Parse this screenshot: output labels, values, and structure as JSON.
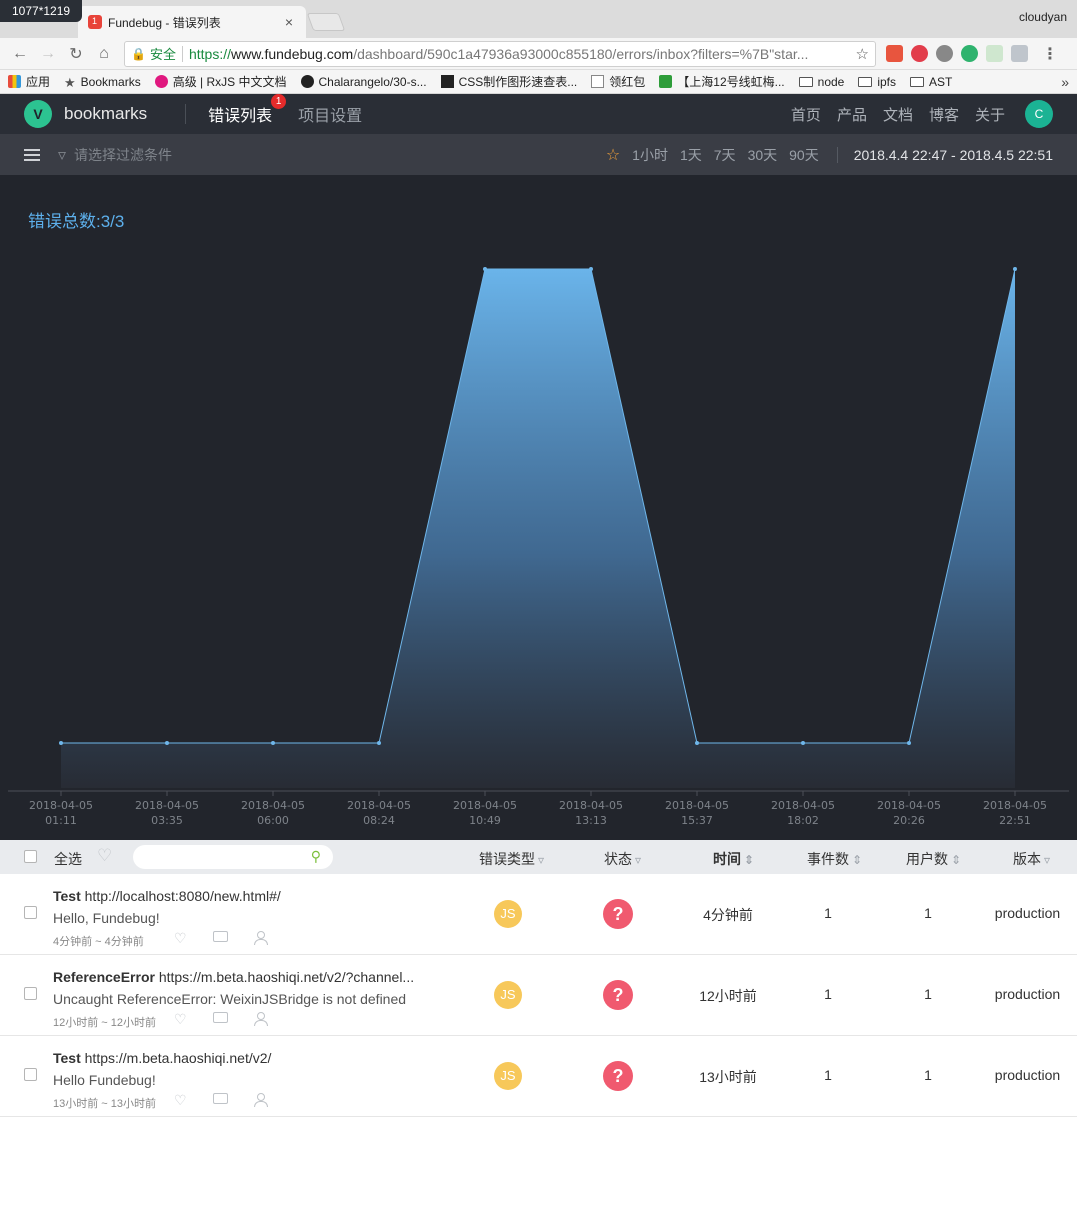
{
  "overlay": {
    "size_badge": "1077*1219"
  },
  "browser": {
    "tab_title": "Fundebug - 错误列表",
    "tab_close": "×",
    "profile_name": "cloudyan",
    "secure_label": "安全",
    "url_scheme": "https://",
    "url_host": "www.fundebug.com",
    "url_path": "/dashboard/590c1a47936a93000c855180/errors/inbox?filters=%7B\"star..."
  },
  "bookmarks_bar": {
    "items": [
      {
        "label": "应用",
        "icon": "apps-icon"
      },
      {
        "label": "Bookmarks",
        "icon": "star-icon"
      },
      {
        "label": "高级 | RxJS 中文文档",
        "icon": "rxjs-icon"
      },
      {
        "label": "Chalarangelo/30-s...",
        "icon": "github-icon"
      },
      {
        "label": "CSS制作图形速查表...",
        "icon": "css-icon"
      },
      {
        "label": "领红包",
        "icon": "doc-icon"
      },
      {
        "label": "【上海12号线虹梅...",
        "icon": "green-icon"
      },
      {
        "label": "node",
        "icon": "folder-icon"
      },
      {
        "label": "ipfs",
        "icon": "folder-icon"
      },
      {
        "label": "AST",
        "icon": "folder-icon"
      }
    ],
    "more": "»"
  },
  "app": {
    "logo_letter": "V",
    "project_name": "bookmarks",
    "tabs": [
      {
        "label": "错误列表",
        "badge": "1"
      },
      {
        "label": "项目设置"
      }
    ],
    "nav": [
      "首页",
      "产品",
      "文档",
      "博客",
      "关于"
    ],
    "user_initial": "C"
  },
  "filterbar": {
    "placeholder": "请选择过滤条件",
    "ranges": [
      "1小时",
      "1天",
      "7天",
      "30天",
      "90天"
    ],
    "date_range": "2018.4.4 22:47 - 2018.4.5 22:51"
  },
  "summary": {
    "total_errors": "错误总数:3/3"
  },
  "colors": {
    "chart_line": "#6fb6ea",
    "chart_fill_top": "#6ab4ea",
    "chart_bg": "#22252c",
    "accent_green": "#2cc391",
    "status_red": "#f05a6f",
    "js_yellow": "#f7c85a"
  },
  "chart_data": {
    "type": "area",
    "title": "错误总数:3/3",
    "x": [
      "2018-04-05 01:11",
      "2018-04-05 03:35",
      "2018-04-05 06:00",
      "2018-04-05 08:24",
      "2018-04-05 10:49",
      "2018-04-05 13:13",
      "2018-04-05 15:37",
      "2018-04-05 18:02",
      "2018-04-05 20:26",
      "2018-04-05 22:51"
    ],
    "tick_dates": [
      "2018-04-05",
      "2018-04-05",
      "2018-04-05",
      "2018-04-05",
      "2018-04-05",
      "2018-04-05",
      "2018-04-05",
      "2018-04-05",
      "2018-04-05",
      "2018-04-05"
    ],
    "tick_times": [
      "01:11",
      "03:35",
      "06:00",
      "08:24",
      "10:49",
      "13:13",
      "15:37",
      "18:02",
      "20:26",
      "22:51"
    ],
    "series": [
      {
        "values": [
          0,
          0,
          0,
          0,
          1,
          1,
          0,
          0,
          0,
          1
        ]
      }
    ],
    "ylim": [
      0,
      1
    ],
    "grid": false,
    "xlabel": "",
    "ylabel": ""
  },
  "table": {
    "select_all": "全选",
    "columns": {
      "type": "错误类型",
      "status": "状态",
      "time": "时间",
      "events": "事件数",
      "users": "用户数",
      "version": "版本"
    },
    "rows": [
      {
        "name": "Test",
        "url": "http://localhost:8080/new.html#/",
        "message": "Hello, Fundebug!",
        "meta": "4分钟前 ~ 4分钟前",
        "type": "JS",
        "status": "?",
        "time": "4分钟前",
        "events": "1",
        "users": "1",
        "version": "production"
      },
      {
        "name": "ReferenceError",
        "url": "https://m.beta.haoshiqi.net/v2/?channel...",
        "message": "Uncaught ReferenceError: WeixinJSBridge is not defined",
        "meta": "12小时前 ~ 12小时前",
        "type": "JS",
        "status": "?",
        "time": "12小时前",
        "events": "1",
        "users": "1",
        "version": "production"
      },
      {
        "name": "Test",
        "url": "https://m.beta.haoshiqi.net/v2/",
        "message": "Hello Fundebug!",
        "meta": "13小时前 ~ 13小时前",
        "type": "JS",
        "status": "?",
        "time": "13小时前",
        "events": "1",
        "users": "1",
        "version": "production"
      }
    ]
  }
}
